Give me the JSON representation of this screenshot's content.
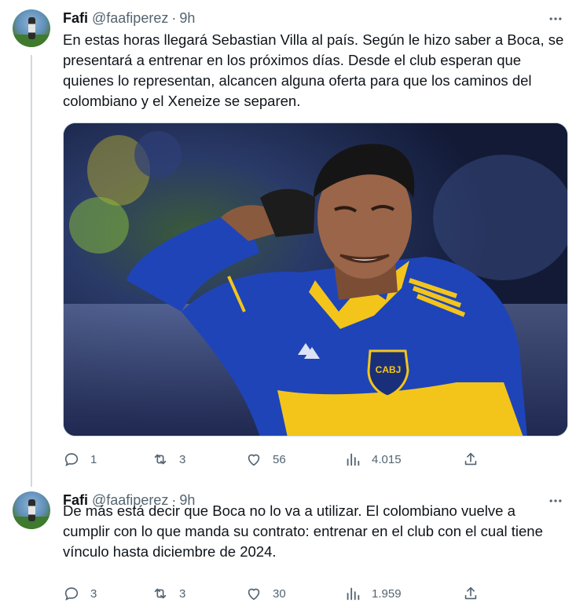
{
  "tweets": [
    {
      "author_name": "Fafi",
      "handle": "@faafiperez",
      "separator": "·",
      "time": "9h",
      "text": "En estas horas llegará Sebastian Villa al país. Según le hizo saber a Boca, se presentará a entrenar en los próximos días. Desde el club esperan que quienes lo representan, alcancen alguna oferta para que los caminos del colombiano y el Xeneize se separen.",
      "image_alt": "Sebastián Villa con la camiseta de Boca",
      "crest_text": "CABJ",
      "stats": {
        "replies": "1",
        "retweets": "3",
        "likes": "56",
        "views": "4.015"
      }
    },
    {
      "author_name": "Fafi",
      "handle": "@faafiperez",
      "separator": "·",
      "time": "9h",
      "text": "De más está decir que Boca no lo va a utilizar. El colombiano vuelve a cumplir con lo que manda su contrato: entrenar en el club con el cual tiene vínculo hasta diciembre de 2024.",
      "stats": {
        "replies": "3",
        "retweets": "3",
        "likes": "30",
        "views": "1.959"
      }
    }
  ],
  "icons": {
    "reply": "reply-icon",
    "retweet": "retweet-icon",
    "like": "heart-icon",
    "views": "analytics-icon",
    "share": "share-icon",
    "more": "more-icon"
  },
  "colors": {
    "text": "#0f1419",
    "secondary": "#536471",
    "jersey_blue": "#1f44b8",
    "jersey_yellow": "#f3c51b"
  }
}
